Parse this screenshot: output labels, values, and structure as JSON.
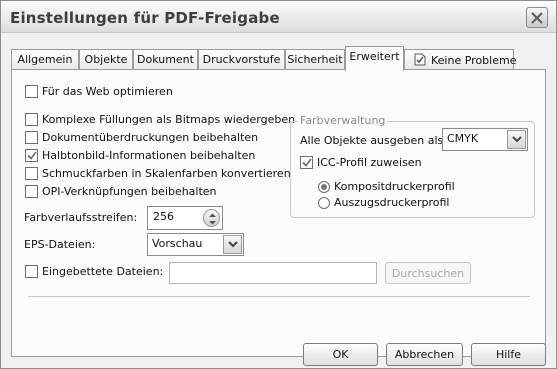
{
  "title": "Einstellungen für PDF-Freigabe",
  "tabs": [
    {
      "label": "Allgemein"
    },
    {
      "label": "Objekte"
    },
    {
      "label": "Dokument"
    },
    {
      "label": "Druckvorstufe"
    },
    {
      "label": "Sicherheit"
    },
    {
      "label": "Erweitert"
    },
    {
      "label": "Keine Probleme"
    }
  ],
  "active_tab": "Erweitert",
  "options": {
    "web_optimize": {
      "label": "Für das Web optimieren",
      "checked": false
    },
    "complex_fills": {
      "label": "Komplexe Füllungen als Bitmaps wiedergeben",
      "checked": false
    },
    "doc_overprints": {
      "label": "Dokumentüberdruckungen beibehalten",
      "checked": false
    },
    "halftone": {
      "label": "Halbtonbild-Informationen beibehalten",
      "checked": true
    },
    "spot_colors": {
      "label": "Schmuckfarben in Skalenfarben konvertieren",
      "checked": false
    },
    "opi_links": {
      "label": "OPI-Verknüpfungen beibehalten",
      "checked": false
    }
  },
  "fountain_steps": {
    "label": "Farbverlaufsstreifen:",
    "value": "256"
  },
  "eps_files": {
    "label": "EPS-Dateien:",
    "value": "Vorschau"
  },
  "embedded_files": {
    "label": "Eingebettete Dateien:",
    "value": "",
    "checked": false,
    "browse_label": "Durchsuchen"
  },
  "color_management": {
    "group_label": "Farbverwaltung",
    "output_label": "Alle Objekte ausgeben als:",
    "output_value": "CMYK",
    "icc_label": "ICC-Profil zuweisen",
    "icc_checked": true,
    "radio_composite": {
      "label": "Kompositdruckerprofil",
      "selected": true
    },
    "radio_separations": {
      "label": "Auszugsdruckerprofil",
      "selected": false
    }
  },
  "buttons": {
    "ok": "OK",
    "cancel": "Abbrechen",
    "help": "Hilfe"
  },
  "icons": {
    "close": "close-icon",
    "tab_status": "document-check-icon",
    "spinner": "spinner-arrows-icon",
    "dropdown": "chevron-down-icon"
  }
}
